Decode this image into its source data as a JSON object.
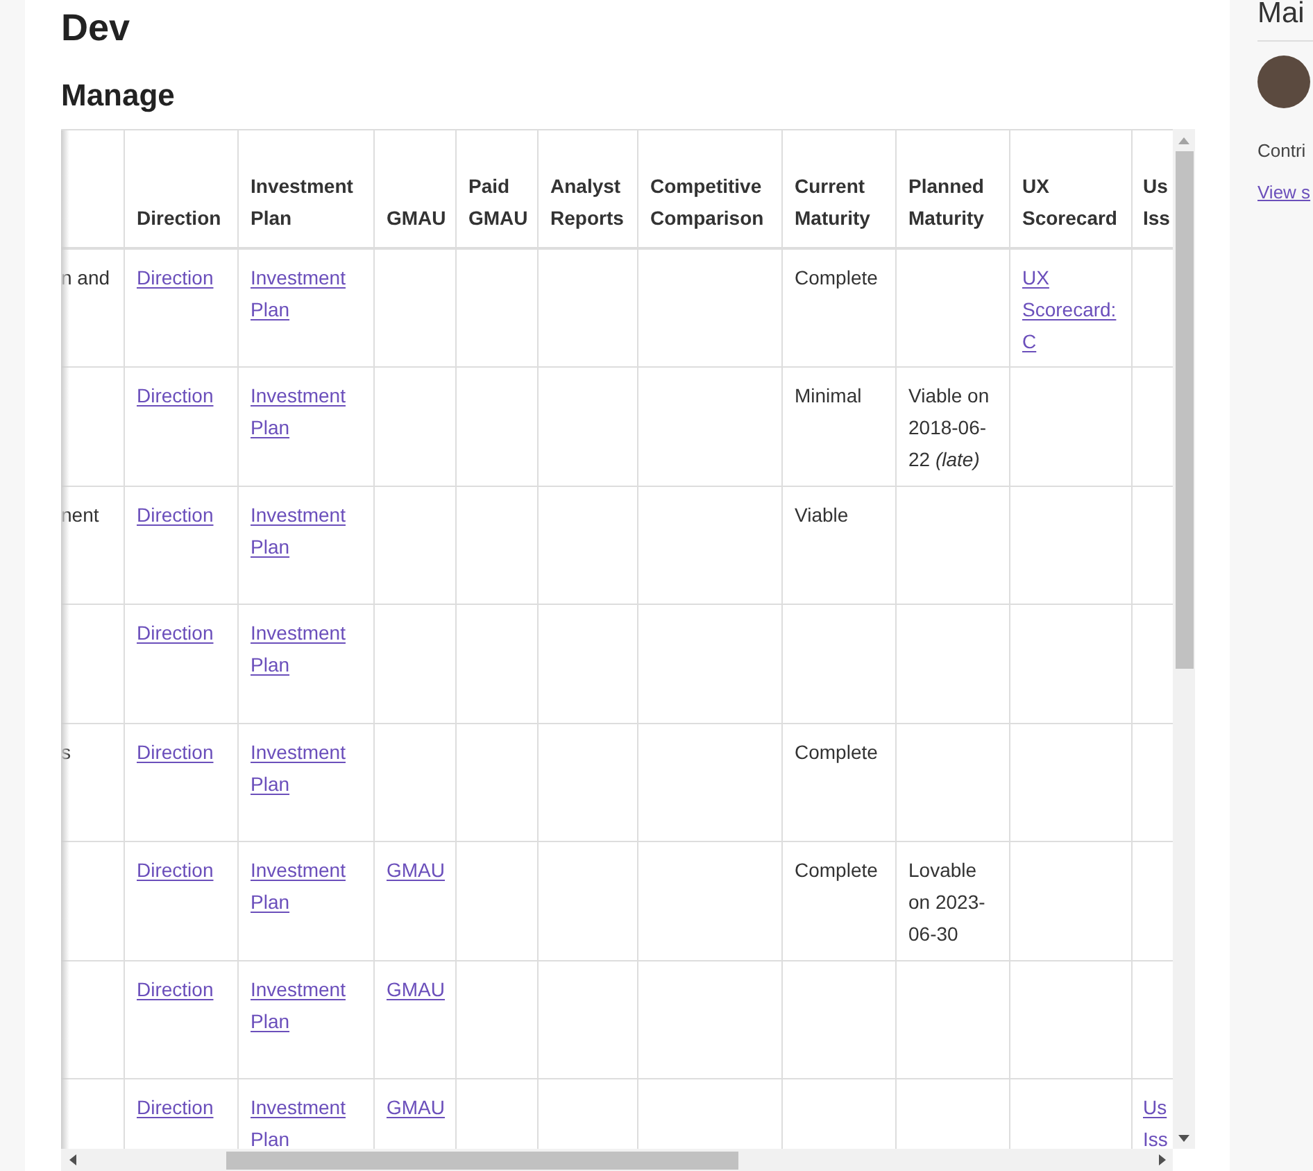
{
  "page": {
    "title": "Dev",
    "section": "Manage"
  },
  "table": {
    "columns": [
      {
        "label": "Direction"
      },
      {
        "label": "Investment Plan"
      },
      {
        "label": "GMAU"
      },
      {
        "label": "Paid GMAU"
      },
      {
        "label": "Analyst Reports"
      },
      {
        "label": "Competitive Comparison"
      },
      {
        "label": "Current Maturity"
      },
      {
        "label": "Planned Maturity"
      },
      {
        "label": "UX Scorecard"
      },
      {
        "label": "Us Iss"
      }
    ],
    "rows": [
      {
        "column_1": "n and",
        "cells": [
          {
            "kind": "link",
            "text": "Direction"
          },
          {
            "kind": "link",
            "text": "Investment Plan"
          },
          null,
          null,
          null,
          null,
          {
            "kind": "text",
            "text": "Complete"
          },
          null,
          {
            "kind": "link",
            "text": "UX Scorecard: C"
          },
          null
        ]
      },
      {
        "cells": [
          {
            "kind": "link",
            "text": "Direction"
          },
          {
            "kind": "link",
            "text": "Investment Plan"
          },
          null,
          null,
          null,
          null,
          {
            "kind": "text",
            "text": "Minimal"
          },
          {
            "kind": "text",
            "text": "Viable on 2018-06-22 *(late)*"
          },
          null,
          null
        ]
      },
      {
        "column_1": "nent",
        "cells": [
          {
            "kind": "link",
            "text": "Direction"
          },
          {
            "kind": "link",
            "text": "Investment Plan"
          },
          null,
          null,
          null,
          null,
          {
            "kind": "text",
            "text": "Viable"
          },
          null,
          null,
          null
        ]
      },
      {
        "cells": [
          {
            "kind": "link",
            "text": "Direction"
          },
          {
            "kind": "link",
            "text": "Investment Plan"
          },
          null,
          null,
          null,
          null,
          null,
          null,
          null,
          null
        ]
      },
      {
        "column_1": "s",
        "cells": [
          {
            "kind": "link",
            "text": "Direction"
          },
          {
            "kind": "link",
            "text": "Investment Plan"
          },
          null,
          null,
          null,
          null,
          {
            "kind": "text",
            "text": "Complete"
          },
          null,
          null,
          null
        ]
      },
      {
        "cells": [
          {
            "kind": "link",
            "text": "Direction"
          },
          {
            "kind": "link",
            "text": "Investment Plan"
          },
          {
            "kind": "link",
            "text": "GMAU"
          },
          null,
          null,
          null,
          {
            "kind": "text",
            "text": "Complete"
          },
          {
            "kind": "text",
            "text": "Lovable on 2023-06-30"
          },
          null,
          null
        ]
      },
      {
        "cells": [
          {
            "kind": "link",
            "text": "Direction"
          },
          {
            "kind": "link",
            "text": "Investment Plan"
          },
          {
            "kind": "link",
            "text": "GMAU"
          },
          null,
          null,
          null,
          null,
          null,
          null,
          null
        ]
      },
      {
        "cells": [
          {
            "kind": "link",
            "text": "Direction"
          },
          {
            "kind": "link",
            "text": "Investment Plan"
          },
          {
            "kind": "link",
            "text": "GMAU"
          },
          null,
          null,
          null,
          null,
          null,
          null,
          {
            "kind": "link",
            "text": "Us Iss"
          }
        ]
      }
    ]
  },
  "sidebar": {
    "heading": "Mai",
    "text": "Contri",
    "link": "View s"
  }
}
